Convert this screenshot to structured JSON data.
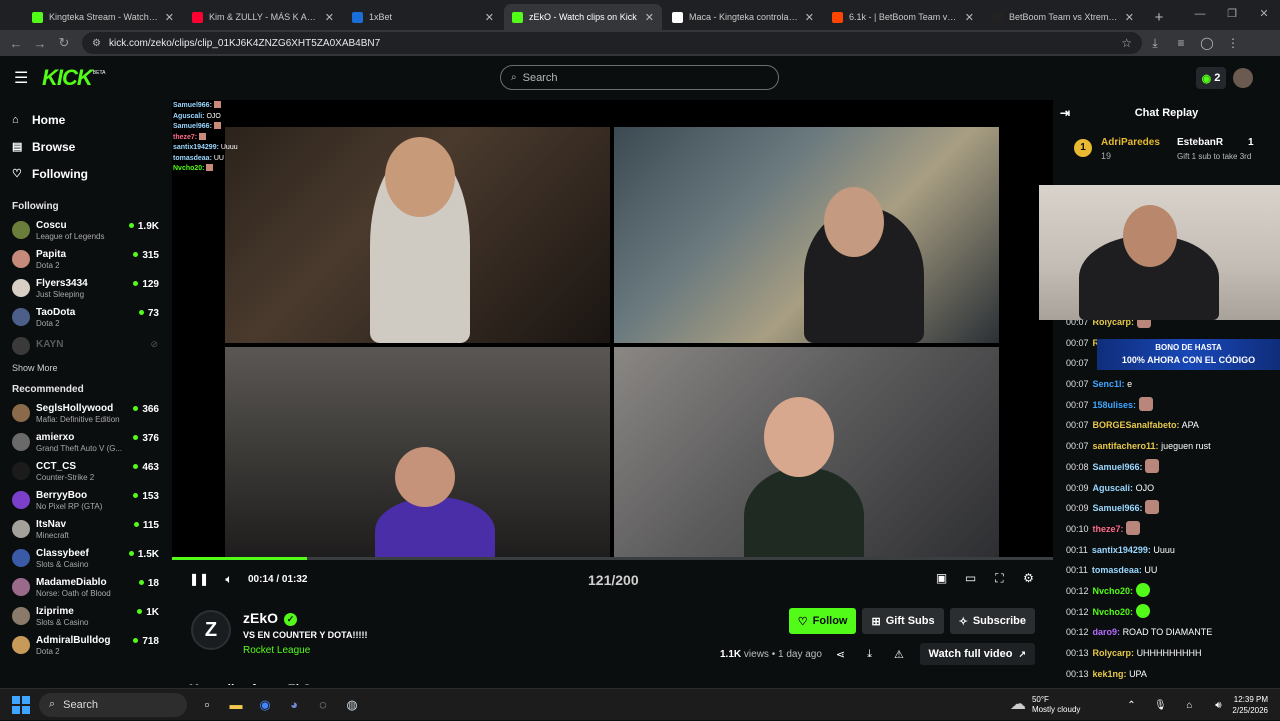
{
  "browser": {
    "tabs": [
      {
        "title": "Kingteka Stream - Watch Live o",
        "fav_color": "#53fc18",
        "active": false
      },
      {
        "title": "Kim & ZULLY - MÁS K AMIGOS",
        "fav_color": "#ff0033",
        "active": false
      },
      {
        "title": "1xBet",
        "fav_color": "#1a6ed8",
        "active": false
      },
      {
        "title": "zEkO - Watch clips on Kick",
        "fav_color": "#53fc18",
        "active": true
      },
      {
        "title": "Maca - Kingteka controla a tu e",
        "fav_color": "#ffffff",
        "active": false
      },
      {
        "title": "6.1k - | BetBoom Team vs Xtrem",
        "fav_color": "#ff4500",
        "active": false
      },
      {
        "title": "BetBoom Team vs Xtreme Gam",
        "fav_color": "#222222",
        "active": false
      }
    ],
    "url": "kick.com/zeko/clips/clip_01KJ6K4ZNZG6XHT5ZA0XAB4BN7"
  },
  "header": {
    "logo": "KICK",
    "beta": "BETA",
    "search_placeholder": "Search",
    "badge_count": "2"
  },
  "sidebar": {
    "nav": [
      {
        "label": "Home",
        "icon": "home-icon"
      },
      {
        "label": "Browse",
        "icon": "browse-icon"
      },
      {
        "label": "Following",
        "icon": "heart-icon"
      }
    ],
    "following_title": "Following",
    "following": [
      {
        "name": "Coscu",
        "game": "League of Legends",
        "viewers": "1.9K",
        "color": "#6a7d3a"
      },
      {
        "name": "Papita",
        "game": "Dota 2",
        "viewers": "315",
        "color": "#c58a7a"
      },
      {
        "name": "Flyers3434",
        "game": "Just Sleeping",
        "viewers": "129",
        "color": "#d8cfc4"
      },
      {
        "name": "TaoDota",
        "game": "Dota 2",
        "viewers": "73",
        "color": "#4b5f8a"
      }
    ],
    "offline": "KAYN",
    "show_more": "Show More",
    "recommended_title": "Recommended",
    "recommended": [
      {
        "name": "SeglsHollywood",
        "game": "Mafia: Definitive Edition",
        "viewers": "366",
        "color": "#8a6a4a"
      },
      {
        "name": "amierxo",
        "game": "Grand Theft Auto V (G...",
        "viewers": "376",
        "color": "#6a6a6a"
      },
      {
        "name": "CCT_CS",
        "game": "Counter-Strike 2",
        "viewers": "463",
        "color": "#1b1b1b"
      },
      {
        "name": "BerryyBoo",
        "game": "No Pixel RP (GTA)",
        "viewers": "153",
        "color": "#7b3fc9"
      },
      {
        "name": "ItsNav",
        "game": "Minecraft",
        "viewers": "115",
        "color": "#a4a09a"
      },
      {
        "name": "Classybeef",
        "game": "Slots & Casino",
        "viewers": "1.5K",
        "color": "#3a5aa8"
      },
      {
        "name": "MadameDiablo",
        "game": "Norse: Oath of Blood",
        "viewers": "18",
        "color": "#9a6a8a"
      },
      {
        "name": "Iziprime",
        "game": "Slots & Casino",
        "viewers": "1K",
        "color": "#8a7a6a"
      },
      {
        "name": "AdmiralBulldog",
        "game": "Dota 2",
        "viewers": "718",
        "color": "#c79a5a"
      }
    ]
  },
  "video": {
    "overlay_chat": [
      {
        "user": "Samuel966:",
        "text": "",
        "color": "#9ad7ff",
        "emote": true
      },
      {
        "user": "Aguscali:",
        "text": "OJO",
        "color": "#9ad7ff",
        "emote": false
      },
      {
        "user": "Samuel966:",
        "text": "",
        "color": "#9ad7ff",
        "emote": true
      },
      {
        "user": "theze7:",
        "text": "",
        "color": "#ff6b8a",
        "emote": true
      },
      {
        "user": "santix194299:",
        "text": "Uuuu",
        "color": "#9ad7ff",
        "emote": false
      },
      {
        "user": "tomasdeaa:",
        "text": "UU",
        "color": "#9ad7ff",
        "emote": false
      },
      {
        "user": "Nvcho20:",
        "text": "",
        "color": "#53fc18",
        "emote": true
      }
    ],
    "progress": 0.153,
    "time": "00:14 / 01:32",
    "counter": "121/200"
  },
  "clip": {
    "channel": "zEkO",
    "title": "VS EN COUNTER Y DOTA!!!!!",
    "category": "Rocket League",
    "views": "1.1K",
    "views_label": "views",
    "age": "• 1 day ago",
    "follow": "Follow",
    "gift": "Gift Subs",
    "subscribe": "Subscribe",
    "watch_full": "Watch full video",
    "more_clips": "More clips from zEkO"
  },
  "chat": {
    "title": "Chat Replay",
    "pinned": {
      "user1": "AdriParedes",
      "count1": "19",
      "user2": "EstebanR",
      "count2": "1",
      "note": "Gift 1 sub to take 3rd",
      "rank": "1"
    },
    "banner_line1": "BONO DE HASTA",
    "banner_line2": "100% AHORA CON EL CÓDIGO",
    "messages": [
      {
        "time": "00:07",
        "user": "Rolycarp:",
        "text": "",
        "color": "#e6c84a",
        "emote": "face"
      },
      {
        "time": "00:07",
        "user": "Re",
        "text": "",
        "color": "#e6c84a",
        "emote": ""
      },
      {
        "time": "00:07",
        "user": "",
        "text": "",
        "color": "#e6c84a",
        "emote": ""
      },
      {
        "time": "00:07",
        "user": "Senc1l:",
        "text": "e",
        "color": "#3ea6ff",
        "emote": ""
      },
      {
        "time": "00:07",
        "user": "158ulises:",
        "text": "",
        "color": "#3ea6ff",
        "emote": "face"
      },
      {
        "time": "00:07",
        "user": "BORGESanalfabeto:",
        "text": "APA",
        "color": "#e6c84a",
        "emote": ""
      },
      {
        "time": "00:07",
        "user": "santifachero11:",
        "text": "jueguen rust",
        "color": "#e6c84a",
        "emote": ""
      },
      {
        "time": "00:08",
        "user": "Samuel966:",
        "text": "",
        "color": "#9ad7ff",
        "emote": "face"
      },
      {
        "time": "00:09",
        "user": "Aguscali:",
        "text": "OJO",
        "color": "#9ad7ff",
        "emote": ""
      },
      {
        "time": "00:09",
        "user": "Samuel966:",
        "text": "",
        "color": "#9ad7ff",
        "emote": "face"
      },
      {
        "time": "00:10",
        "user": "theze7:",
        "text": "",
        "color": "#ff6b8a",
        "emote": "face"
      },
      {
        "time": "00:11",
        "user": "santix194299:",
        "text": "Uuuu",
        "color": "#9ad7ff",
        "emote": ""
      },
      {
        "time": "00:11",
        "user": "tomasdeaa:",
        "text": "UU",
        "color": "#9ad7ff",
        "emote": ""
      },
      {
        "time": "00:12",
        "user": "Nvcho20:",
        "text": "",
        "color": "#53fc18",
        "emote": "kick"
      },
      {
        "time": "00:12",
        "user": "Nvcho20:",
        "text": "",
        "color": "#53fc18",
        "emote": "kick"
      },
      {
        "time": "00:12",
        "user": "daro9:",
        "text": "ROAD TO DIAMANTE",
        "color": "#b46bff",
        "emote": ""
      },
      {
        "time": "00:13",
        "user": "Rolycarp:",
        "text": "UHHHHHHHHH",
        "color": "#e6c84a",
        "emote": ""
      },
      {
        "time": "00:13",
        "user": "kek1ng:",
        "text": "UPA",
        "color": "#e6c84a",
        "emote": ""
      }
    ]
  },
  "taskbar": {
    "search": "Search",
    "weather_temp": "50°F",
    "weather_desc": "Mostly cloudy",
    "time": "12:39 PM",
    "date": "2/25/2026"
  }
}
